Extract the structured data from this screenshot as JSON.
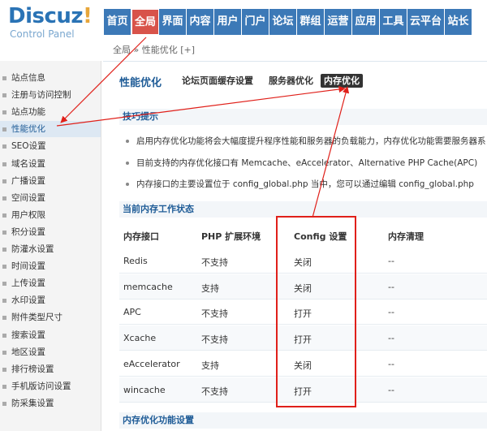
{
  "logo": {
    "name": "Discuz",
    "mark": "!",
    "subtitle": "Control Panel"
  },
  "topnav": [
    {
      "label": "首页",
      "active": false
    },
    {
      "label": "全局",
      "active": true
    },
    {
      "label": "界面",
      "active": false
    },
    {
      "label": "内容",
      "active": false
    },
    {
      "label": "用户",
      "active": false
    },
    {
      "label": "门户",
      "active": false
    },
    {
      "label": "论坛",
      "active": false
    },
    {
      "label": "群组",
      "active": false
    },
    {
      "label": "运营",
      "active": false
    },
    {
      "label": "应用",
      "active": false
    },
    {
      "label": "工具",
      "active": false
    },
    {
      "label": "云平台",
      "active": false
    },
    {
      "label": "站长",
      "active": false
    }
  ],
  "breadcrumb": {
    "text": "全局 » 性能优化",
    "plus": "[+]"
  },
  "sidebar": {
    "items": [
      {
        "label": "站点信息",
        "active": false
      },
      {
        "label": "注册与访问控制",
        "active": false
      },
      {
        "label": "站点功能",
        "active": false
      },
      {
        "label": "性能优化",
        "active": true
      },
      {
        "label": "SEO设置",
        "active": false
      },
      {
        "label": "域名设置",
        "active": false
      },
      {
        "label": "广播设置",
        "active": false
      },
      {
        "label": "空间设置",
        "active": false
      },
      {
        "label": "用户权限",
        "active": false
      },
      {
        "label": "积分设置",
        "active": false
      },
      {
        "label": "防灌水设置",
        "active": false
      },
      {
        "label": "时间设置",
        "active": false
      },
      {
        "label": "上传设置",
        "active": false
      },
      {
        "label": "水印设置",
        "active": false
      },
      {
        "label": "附件类型尺寸",
        "active": false
      },
      {
        "label": "搜索设置",
        "active": false
      },
      {
        "label": "地区设置",
        "active": false
      },
      {
        "label": "排行榜设置",
        "active": false
      },
      {
        "label": "手机版访问设置",
        "active": false
      },
      {
        "label": "防采集设置",
        "active": false
      }
    ]
  },
  "page": {
    "title": "性能优化",
    "subtabs": [
      {
        "label": "论坛页面缓存设置",
        "active": false
      },
      {
        "label": "服务器优化",
        "active": false
      },
      {
        "label": "内存优化",
        "active": true
      }
    ]
  },
  "tips": {
    "heading": "技巧提示",
    "items": [
      "启用内存优化功能将会大幅度提升程序性能和服务器的负载能力，内存优化功能需要服务器系",
      "目前支持的内存优化接口有 Memcache、eAccelerator、Alternative PHP Cache(APC)",
      "内存接口的主要设置位于 config_global.php 当中，您可以通过编辑 config_global.php"
    ]
  },
  "status": {
    "heading": "当前内存工作状态",
    "columns": [
      "内存接口",
      "PHP 扩展环境",
      "Config 设置",
      "内存清理"
    ],
    "rows": [
      {
        "iface": "Redis",
        "php": "不支持",
        "config": "关闭",
        "clean": "--"
      },
      {
        "iface": "memcache",
        "php": "支持",
        "config": "关闭",
        "clean": "--"
      },
      {
        "iface": "APC",
        "php": "不支持",
        "config": "打开",
        "clean": "--"
      },
      {
        "iface": "Xcache",
        "php": "不支持",
        "config": "打开",
        "clean": "--"
      },
      {
        "iface": "eAccelerator",
        "php": "支持",
        "config": "关闭",
        "clean": "--"
      },
      {
        "iface": "wincache",
        "php": "不支持",
        "config": "打开",
        "clean": "--"
      }
    ]
  },
  "features": {
    "heading": "内存优化功能设置"
  },
  "colors": {
    "brand_blue": "#3c79b7",
    "active_red": "#d8534a",
    "annotation_red": "#e0201a",
    "link_blue": "#1f5c97"
  }
}
